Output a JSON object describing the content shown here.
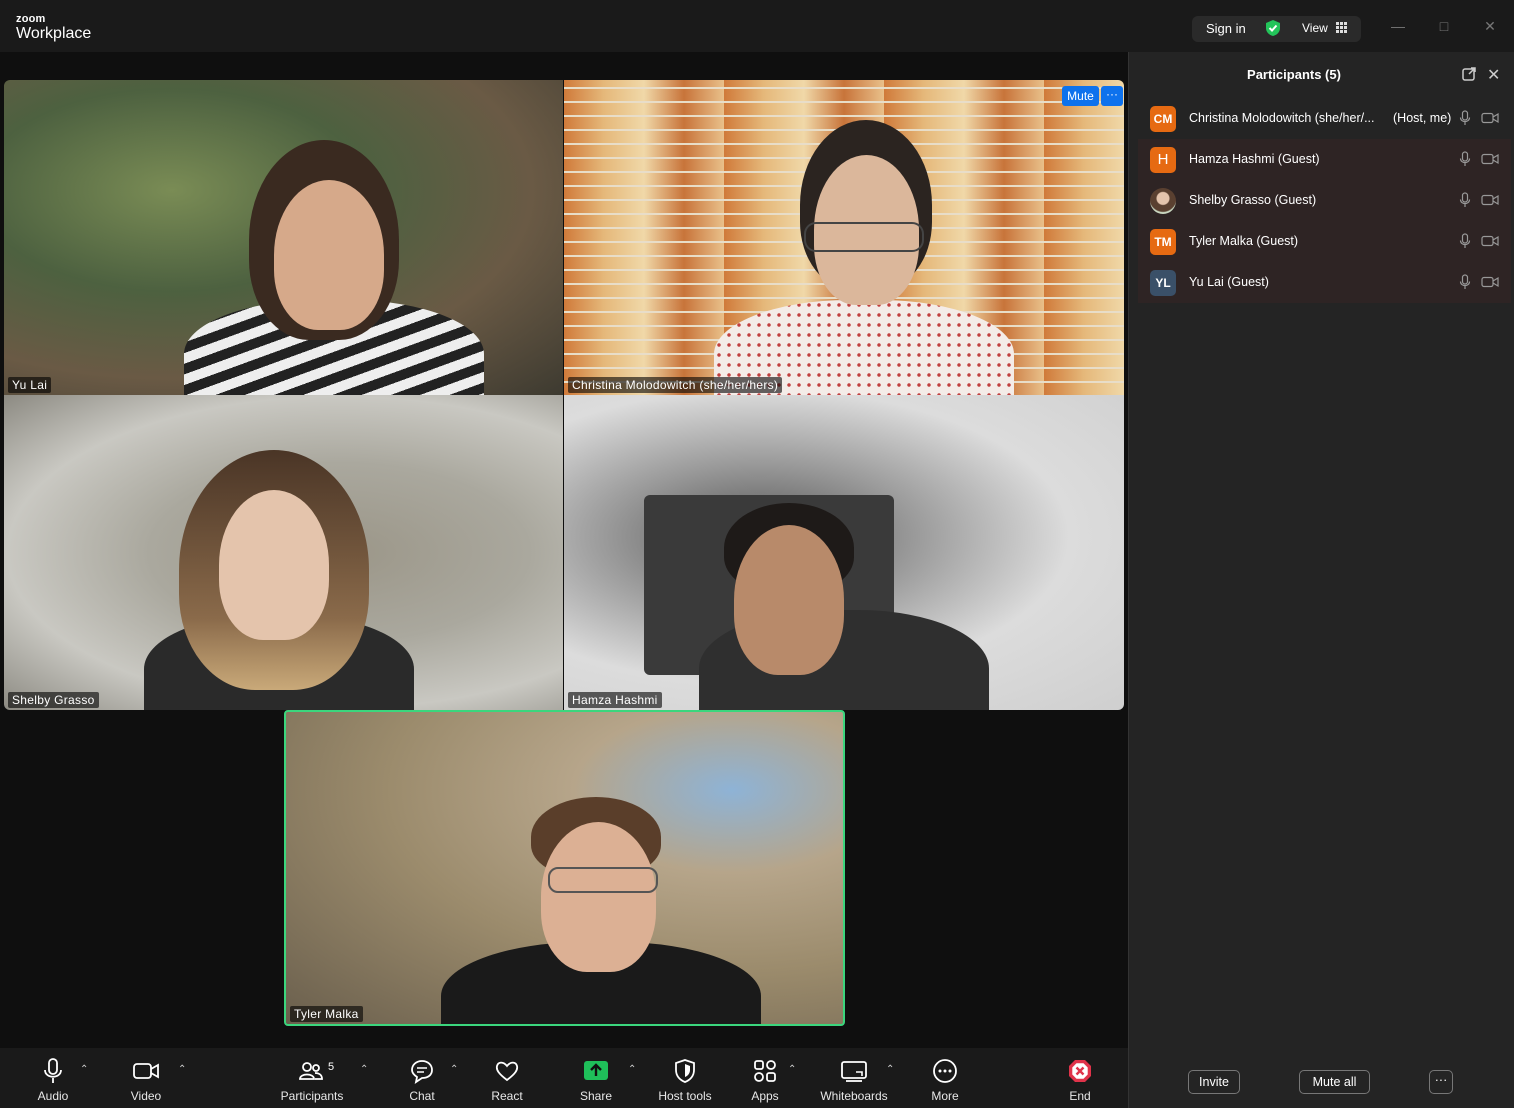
{
  "app": {
    "brand_top": "zoom",
    "brand_bottom": "Workplace"
  },
  "titlebar": {
    "sign_in": "Sign in",
    "view": "View"
  },
  "tiles": [
    {
      "name": "Yu Lai"
    },
    {
      "name": "Christina Molodowitch (she/her/hers)",
      "mute_label": "Mute",
      "more_label": "···"
    },
    {
      "name": "Shelby Grasso"
    },
    {
      "name": "Hamza Hashmi"
    },
    {
      "name": "Tyler Malka"
    }
  ],
  "participants_panel": {
    "title": "Participants (5)",
    "participants": [
      {
        "initials": "CM",
        "name": "Christina Molodowitch (she/her/...",
        "tag": "(Host, me)",
        "avatar_color": "#e66a12"
      },
      {
        "initials": "H",
        "name": "Hamza Hashmi (Guest)",
        "tag": "",
        "avatar_color": "#e66a12"
      },
      {
        "initials": "",
        "name": "Shelby Grasso (Guest)",
        "tag": "",
        "avatar_color": "#7a6a5a"
      },
      {
        "initials": "TM",
        "name": "Tyler Malka (Guest)",
        "tag": "",
        "avatar_color": "#e66a12"
      },
      {
        "initials": "YL",
        "name": "Yu Lai (Guest)",
        "tag": "",
        "avatar_color": "#3a5068"
      }
    ],
    "invite_label": "Invite",
    "mute_all_label": "Mute all",
    "more_label": "···"
  },
  "toolbar": {
    "audio": "Audio",
    "video": "Video",
    "participants": "Participants",
    "participants_count": "5",
    "chat": "Chat",
    "react": "React",
    "share": "Share",
    "host_tools": "Host tools",
    "apps": "Apps",
    "whiteboards": "Whiteboards",
    "more": "More",
    "end": "End"
  },
  "colors": {
    "accent_blue": "#0e72ed",
    "active_speaker_border": "#3bd67d",
    "share_green": "#1fbf5a",
    "end_red": "#e0334a",
    "avatar_orange": "#e66a12"
  }
}
